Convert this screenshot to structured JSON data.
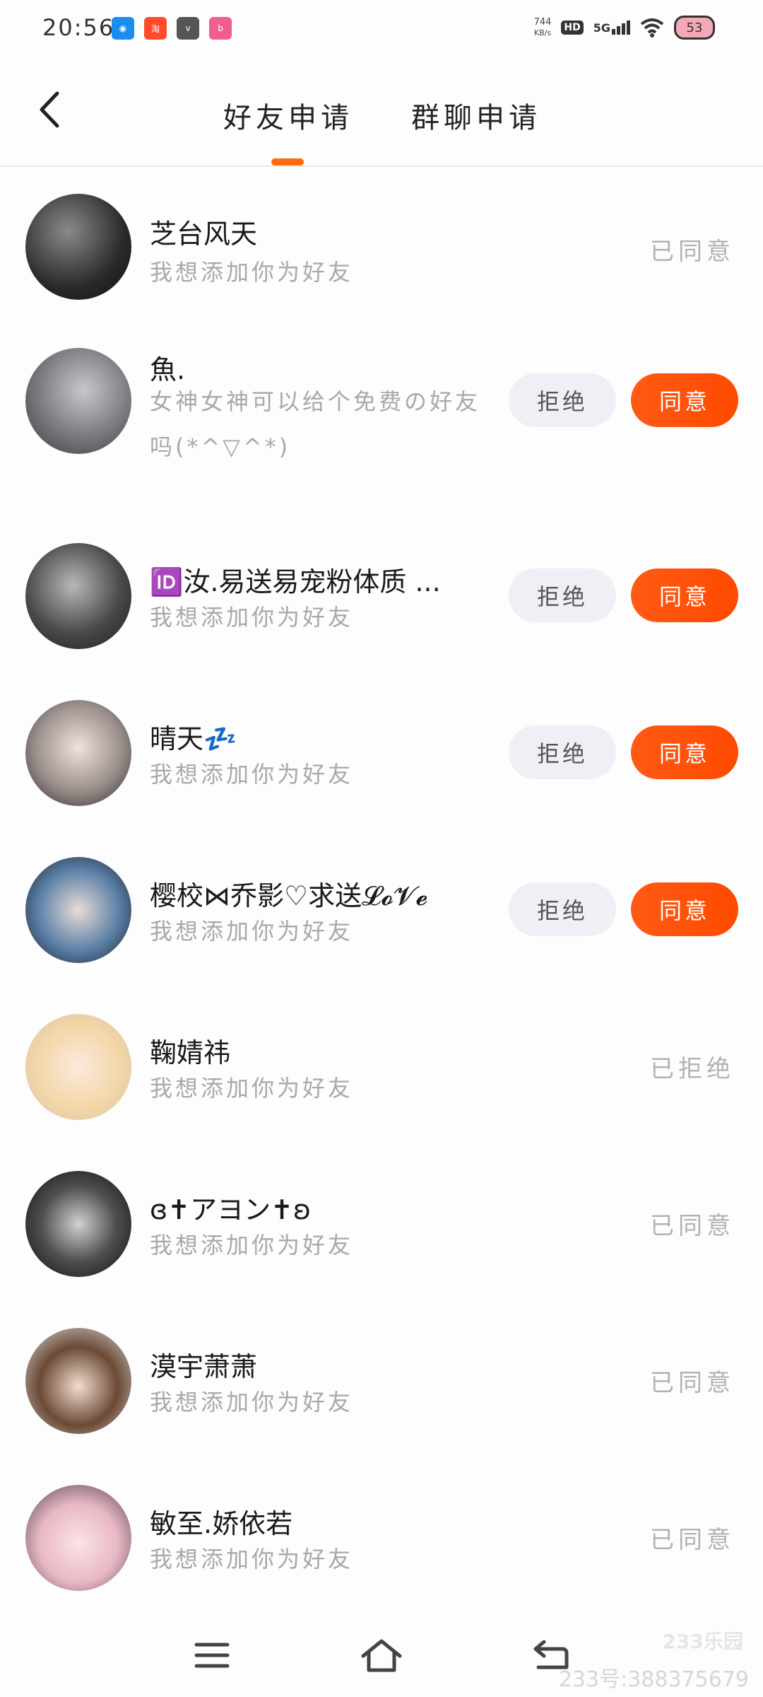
{
  "status_bar": {
    "time": "20:56",
    "net_speed_value": "744",
    "net_speed_unit": "KB/s",
    "hd_label": "HD",
    "network_label": "5G",
    "battery": "53"
  },
  "header": {
    "tabs": [
      {
        "label": "好友申请",
        "active": true
      },
      {
        "label": "群聊申请",
        "active": false
      }
    ]
  },
  "requests": [
    {
      "name": "芝台风天",
      "message": "我想添加你为好友",
      "status": "已同意"
    },
    {
      "name": "魚.",
      "message": "女神女神可以给个免费の好友吗(*^▽^*)",
      "reject_label": "拒绝",
      "accept_label": "同意"
    },
    {
      "name": "🆔汝.易送易宠粉体质 ...",
      "message": "我想添加你为好友",
      "reject_label": "拒绝",
      "accept_label": "同意"
    },
    {
      "name": "晴天💤",
      "message": "我想添加你为好友",
      "reject_label": "拒绝",
      "accept_label": "同意"
    },
    {
      "name": "樱校⋈乔影♡求送𝓛𝓸𝓥𝓮",
      "message": "我想添加你为好友",
      "reject_label": "拒绝",
      "accept_label": "同意"
    },
    {
      "name": "鞠婧祎",
      "message": "我想添加你为好友",
      "status": "已拒绝"
    },
    {
      "name": "ɞ✝アヨン✝ʚ",
      "message": "我想添加你为好友",
      "status": "已同意"
    },
    {
      "name": "漠宇萧萧",
      "message": "我想添加你为好友",
      "status": "已同意"
    },
    {
      "name": "敏至.娇依若",
      "message": "我想添加你为好友",
      "status": "已同意"
    }
  ],
  "watermark": {
    "logo": "233乐园",
    "id": "233号:388375679"
  },
  "colors": {
    "accent": "#ff5a14",
    "reject_bg": "#eff0f5",
    "muted_text": "#a8a8ad"
  }
}
